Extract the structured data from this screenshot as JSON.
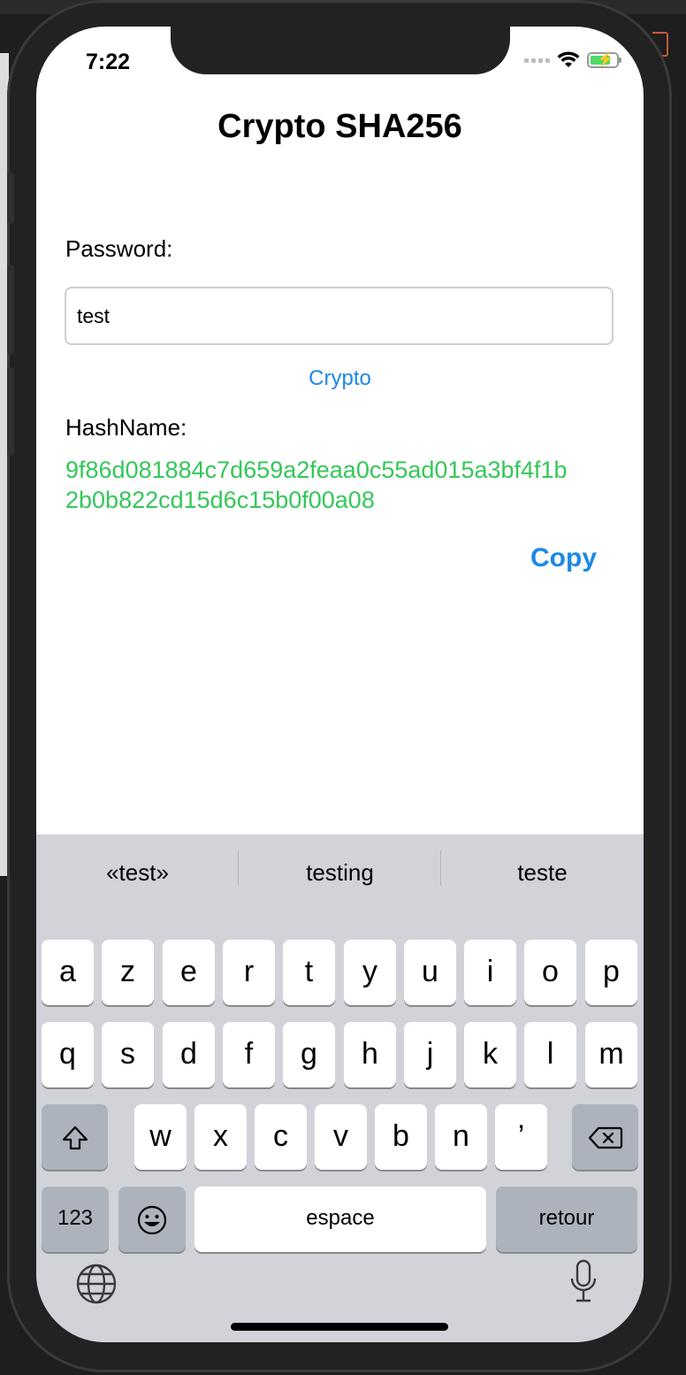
{
  "status_bar": {
    "time": "7:22"
  },
  "app": {
    "title": "Crypto SHA256",
    "password_label": "Password:",
    "password_value": "test",
    "crypto_button": "Crypto",
    "hash_label": "HashName:",
    "hash_line1": "9f86d081884c7d659a2feaa0c55ad015a3bf4f1b",
    "hash_line2": "2b0b822cd15d6c15b0f00a08",
    "copy_button": "Copy"
  },
  "keyboard": {
    "suggestions": [
      "«test»",
      "testing",
      "teste"
    ],
    "row1": [
      "a",
      "z",
      "e",
      "r",
      "t",
      "y",
      "u",
      "i",
      "o",
      "p"
    ],
    "row2": [
      "q",
      "s",
      "d",
      "f",
      "g",
      "h",
      "j",
      "k",
      "l",
      "m"
    ],
    "row3": [
      "w",
      "x",
      "c",
      "v",
      "b",
      "n",
      "’"
    ],
    "numbers_key": "123",
    "space_key": "espace",
    "return_key": "retour"
  },
  "colors": {
    "accent_blue": "#1e88e5",
    "hash_green": "#34c759",
    "keyboard_bg": "#d1d3d9"
  }
}
